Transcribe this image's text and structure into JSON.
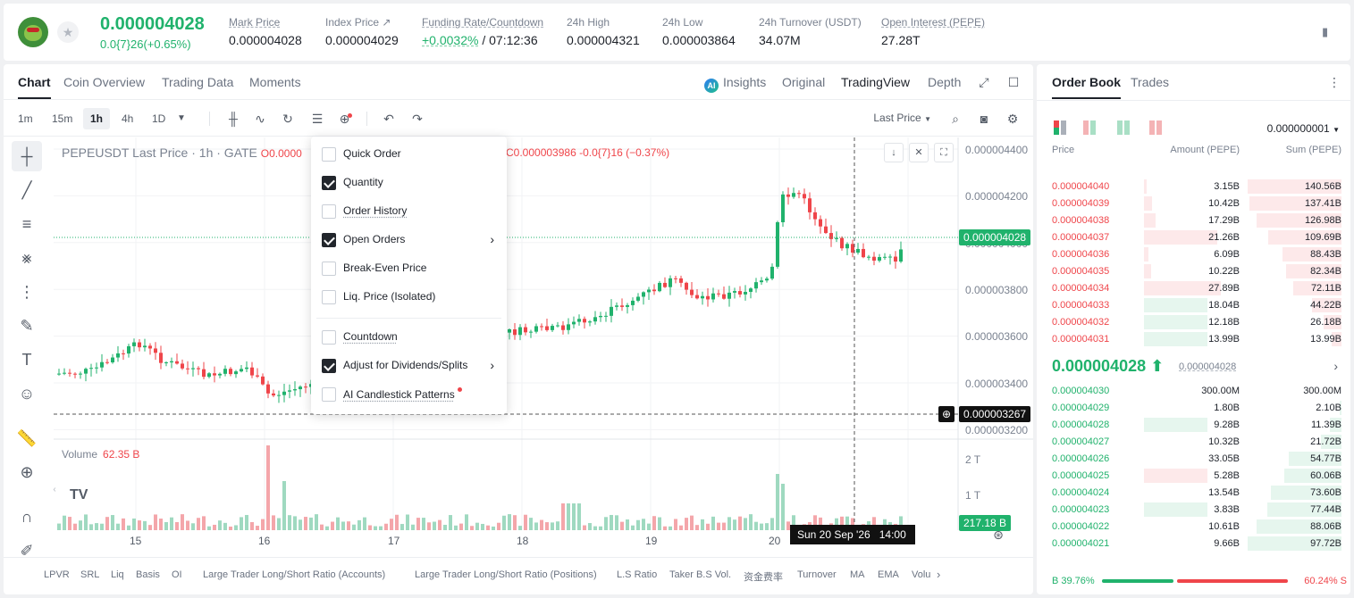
{
  "ticker": {
    "last_price": "0.000004028",
    "change": "0.0{7}26(+0.65%)",
    "mark_price_label": "Mark Price",
    "mark_price": "0.000004028",
    "index_price_label": "Index Price ↗",
    "index_price": "0.000004029",
    "funding_label": "Funding Rate/Countdown",
    "funding_rate": "+0.0032%",
    "countdown": "/ 07:12:36",
    "high_label": "24h High",
    "high": "0.000004321",
    "low_label": "24h Low",
    "low": "0.000003864",
    "turnover_label": "24h Turnover (USDT)",
    "turnover": "34.07M",
    "oi_label": "Open Interest (PEPE)",
    "oi": "27.28T"
  },
  "tabs": [
    "Chart",
    "Coin Overview",
    "Trading Data",
    "Moments"
  ],
  "views": {
    "insights": "Insights",
    "original": "Original",
    "tradingview": "TradingView",
    "depth": "Depth"
  },
  "timeframes": [
    "1m",
    "15m",
    "1h",
    "4h",
    "1D"
  ],
  "last_price_select": "Last Price",
  "legend": {
    "symbol": "PEPEUSDT Last Price · 1h · GATE",
    "ohlc_prefix": "O0.0000",
    "ohlc_suffix": "C0.000003986  -0.0{7}16 (−0.37%)"
  },
  "volume_legend": {
    "label": "Volume",
    "value": "62.35 B"
  },
  "price_axis": [
    "0.000004400",
    "0.000004200",
    "0.000004000",
    "0.000003800",
    "0.000003600",
    "0.000003400",
    "0.000003200"
  ],
  "volume_axis": [
    "2 T",
    "1 T"
  ],
  "current_price_tag": "0.000004028",
  "crosshair_price_tag": "0.000003267",
  "volume_tag": "217.18 B",
  "x_axis": [
    "15",
    "16",
    "17",
    "18",
    "19",
    "20"
  ],
  "crosshair_date": "Sun 20 Sep '26",
  "crosshair_time": "14:00",
  "indicators": [
    "LPVR",
    "SRL",
    "Liq",
    "Basis",
    "OI",
    "Large Trader Long/Short Ratio (Accounts)",
    "Large Trader Long/Short Ratio (Positions)",
    "L.S Ratio",
    "Taker B.S Vol.",
    "资金费率",
    "Turnover",
    "MA",
    "EMA",
    "Volu"
  ],
  "menu": {
    "items": [
      {
        "label": "Quick Order",
        "checked": false
      },
      {
        "label": "Quantity",
        "checked": true
      },
      {
        "label": "Order History",
        "checked": false
      },
      {
        "label": "Open Orders",
        "checked": true
      },
      {
        "label": "Break-Even Price",
        "checked": false
      },
      {
        "label": "Liq. Price (Isolated)",
        "checked": false
      },
      {
        "label": "Countdown",
        "checked": false
      },
      {
        "label": "Adjust for Dividends/Splits",
        "checked": true
      },
      {
        "label": "AI Candlestick Patterns",
        "checked": false
      }
    ]
  },
  "orderbook": {
    "tab_book": "Order Book",
    "tab_trades": "Trades",
    "precision": "0.000000001",
    "col_price": "Price",
    "col_amount": "Amount (PEPE)",
    "col_sum": "Sum (PEPE)",
    "asks": [
      {
        "p": "0.000004040",
        "a": "3.15B",
        "s": "140.56B",
        "af": 0.03,
        "sf": 1.0
      },
      {
        "p": "0.000004039",
        "a": "10.42B",
        "s": "137.41B",
        "af": 0.08,
        "sf": 0.98
      },
      {
        "p": "0.000004038",
        "a": "17.29B",
        "s": "126.98B",
        "af": 0.12,
        "sf": 0.9
      },
      {
        "p": "0.000004037",
        "a": "21.26B",
        "s": "109.69B",
        "af": 0.76,
        "sf": 0.78
      },
      {
        "p": "0.000004036",
        "a": "6.09B",
        "s": "88.43B",
        "af": 0.05,
        "sf": 0.63
      },
      {
        "p": "0.000004035",
        "a": "10.22B",
        "s": "82.34B",
        "af": 0.07,
        "sf": 0.59
      },
      {
        "p": "0.000004034",
        "a": "27.89B",
        "s": "72.11B",
        "af": 0.8,
        "sf": 0.51
      },
      {
        "p": "0.000004033",
        "a": "18.04B",
        "s": "44.22B",
        "af": 0.66,
        "sf": 0.31,
        "green": true
      },
      {
        "p": "0.000004032",
        "a": "12.18B",
        "s": "26.18B",
        "af": 0.66,
        "sf": 0.19,
        "green": true
      },
      {
        "p": "0.000004031",
        "a": "13.99B",
        "s": "13.99B",
        "af": 0.66,
        "sf": 0.1,
        "green": true
      }
    ],
    "mid": "0.000004028 ⬆",
    "mark": "0.000004028",
    "bids": [
      {
        "p": "0.000004030",
        "a": "300.00M",
        "s": "300.00M",
        "af": 0.0,
        "sf": 0.0
      },
      {
        "p": "0.000004029",
        "a": "1.80B",
        "s": "2.10B",
        "af": 0.0,
        "sf": 0.02
      },
      {
        "p": "0.000004028",
        "a": "9.28B",
        "s": "11.39B",
        "af": 0.66,
        "sf": 0.12
      },
      {
        "p": "0.000004027",
        "a": "10.32B",
        "s": "21.72B",
        "af": 0.0,
        "sf": 0.22
      },
      {
        "p": "0.000004026",
        "a": "33.05B",
        "s": "54.77B",
        "af": 0.0,
        "sf": 0.56
      },
      {
        "p": "0.000004025",
        "a": "5.28B",
        "s": "60.06B",
        "af": 0.66,
        "sf": 0.61,
        "red": true
      },
      {
        "p": "0.000004024",
        "a": "13.54B",
        "s": "73.60B",
        "af": 0.0,
        "sf": 0.75
      },
      {
        "p": "0.000004023",
        "a": "3.83B",
        "s": "77.44B",
        "af": 0.66,
        "sf": 0.79
      },
      {
        "p": "0.000004022",
        "a": "10.61B",
        "s": "88.06B",
        "af": 0.0,
        "sf": 0.9
      },
      {
        "p": "0.000004021",
        "a": "9.66B",
        "s": "97.72B",
        "af": 0.0,
        "sf": 1.0
      }
    ],
    "buy_ratio": "B 39.76%",
    "sell_ratio": "60.24% S"
  }
}
